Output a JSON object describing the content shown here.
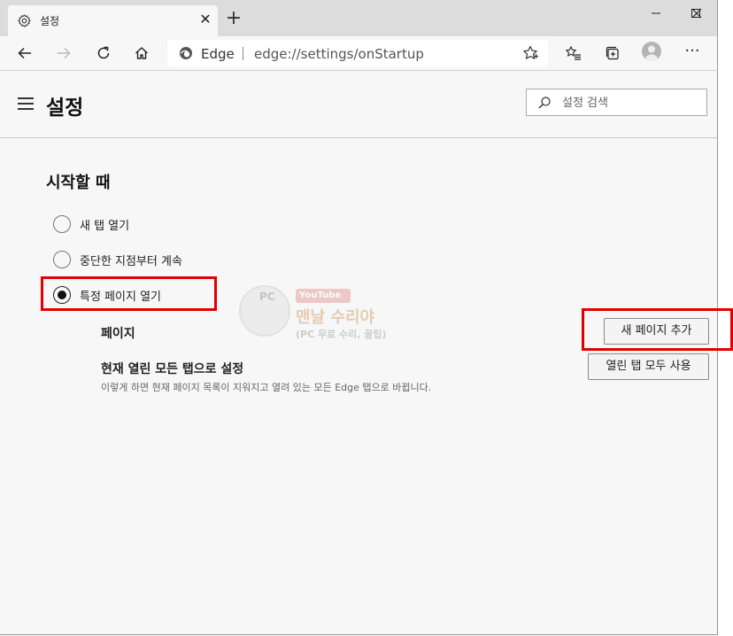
{
  "window": {
    "tab_title": "설정",
    "tab_icon": "gear-icon",
    "close_tab_symbol": "✕",
    "new_tab_symbol": "+",
    "controls": [
      "minimize",
      "maximize",
      "close"
    ]
  },
  "toolbar": {
    "buttons": [
      "back-arrow-icon",
      "forward-arrow-icon",
      "refresh-icon",
      "home-icon"
    ],
    "edge_label": "Edge",
    "url": "edge://settings/onStartup",
    "right_buttons": [
      "favorites-icon",
      "collections-icon",
      "profile-avatar",
      "more-menu-icon"
    ],
    "more_symbol": "···"
  },
  "header": {
    "title": "설정",
    "search_placeholder": "설정 검색"
  },
  "startup": {
    "section_title": "시작할 때",
    "options": [
      {
        "label": "새 탭 열기",
        "checked": false
      },
      {
        "label": "중단한 지점부터 계속",
        "checked": false
      },
      {
        "label": "특정 페이지 열기",
        "checked": true
      }
    ],
    "pages_label": "페이지",
    "add_page_button": "새 페이지 추가",
    "use_open_tabs_title": "현재 열린 모든 탭으로 설정",
    "use_open_tabs_desc": "이렇게 하면 현재 페이지 목록이 지워지고 열려 있는 모든 Edge 탭으로 바뀝니다.",
    "use_open_tabs_button": "열린 탭 모두 사용"
  },
  "watermark": {
    "pc": "PC",
    "youtube": "YouTube",
    "title": "맨날 수리야",
    "subtitle": "(PC 무료 수리, 꿀팁)"
  },
  "colors": {
    "highlight": "#e00000",
    "accent": "#111111",
    "background": "#f7f7f7"
  }
}
